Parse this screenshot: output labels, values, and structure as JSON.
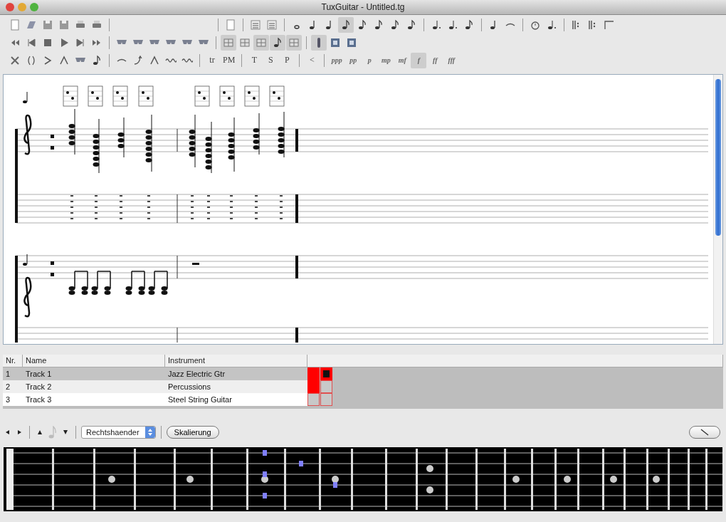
{
  "window": {
    "title": "TuxGuitar - Untitled.tg"
  },
  "toolbar": {
    "text_tools": [
      "tr",
      "PM",
      "T",
      "S",
      "P",
      "<"
    ],
    "dynamics": [
      {
        "label": "ppp",
        "selected": false
      },
      {
        "label": "pp",
        "selected": false
      },
      {
        "label": "p",
        "selected": false
      },
      {
        "label": "mp",
        "selected": false
      },
      {
        "label": "mf",
        "selected": false
      },
      {
        "label": "f",
        "selected": true
      },
      {
        "label": "ff",
        "selected": false
      },
      {
        "label": "fff",
        "selected": false
      }
    ]
  },
  "track_table": {
    "columns": [
      "Nr.",
      "Name",
      "Instrument"
    ],
    "rows": [
      {
        "nr": "1",
        "name": "Track 1",
        "instrument": "Jazz Electric Gtr",
        "selected": true,
        "indicator_1": true,
        "indicator_2": true
      },
      {
        "nr": "2",
        "name": "Track 2",
        "instrument": "Percussions",
        "selected": false,
        "indicator_1": true,
        "indicator_2": false
      },
      {
        "nr": "3",
        "name": "Track 3",
        "instrument": "Steel String Guitar",
        "selected": false,
        "indicator_1": false,
        "indicator_2": false
      }
    ]
  },
  "fretboard_bar": {
    "hand_select": "Rechtshaender",
    "scale_button": "Skalierung"
  }
}
